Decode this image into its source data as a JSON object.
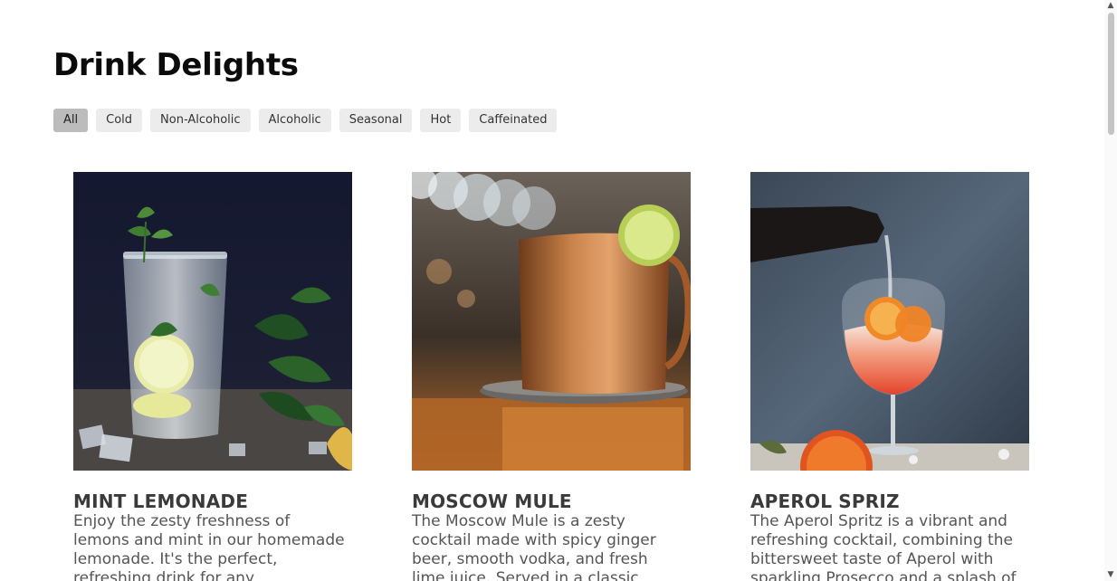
{
  "page": {
    "title": "Drink Delights"
  },
  "filters": [
    {
      "label": "All",
      "active": true
    },
    {
      "label": "Cold",
      "active": false
    },
    {
      "label": "Non-Alcoholic",
      "active": false
    },
    {
      "label": "Alcoholic",
      "active": false
    },
    {
      "label": "Seasonal",
      "active": false
    },
    {
      "label": "Hot",
      "active": false
    },
    {
      "label": "Caffeinated",
      "active": false
    }
  ],
  "drinks": [
    {
      "name": "MINT LEMONADE",
      "description": "Enjoy the zesty freshness of lemons and mint in our homemade lemonade. It's the perfect, refreshing drink for any",
      "image": "mint-lemonade-photo"
    },
    {
      "name": "MOSCOW MULE",
      "description": "The Moscow Mule is a zesty cocktail made with spicy ginger beer, smooth vodka, and fresh lime juice. Served in a classic",
      "image": "moscow-mule-photo"
    },
    {
      "name": "APEROL SPRIZ",
      "description": "The Aperol Spritz is a vibrant and refreshing cocktail, combining the bittersweet taste of Aperol with sparkling Prosecco and a splash of",
      "image": "aperol-spritz-photo"
    }
  ],
  "scrollbar": {
    "up_icon": "chevron-up-icon",
    "down_icon": "chevron-down-icon"
  }
}
